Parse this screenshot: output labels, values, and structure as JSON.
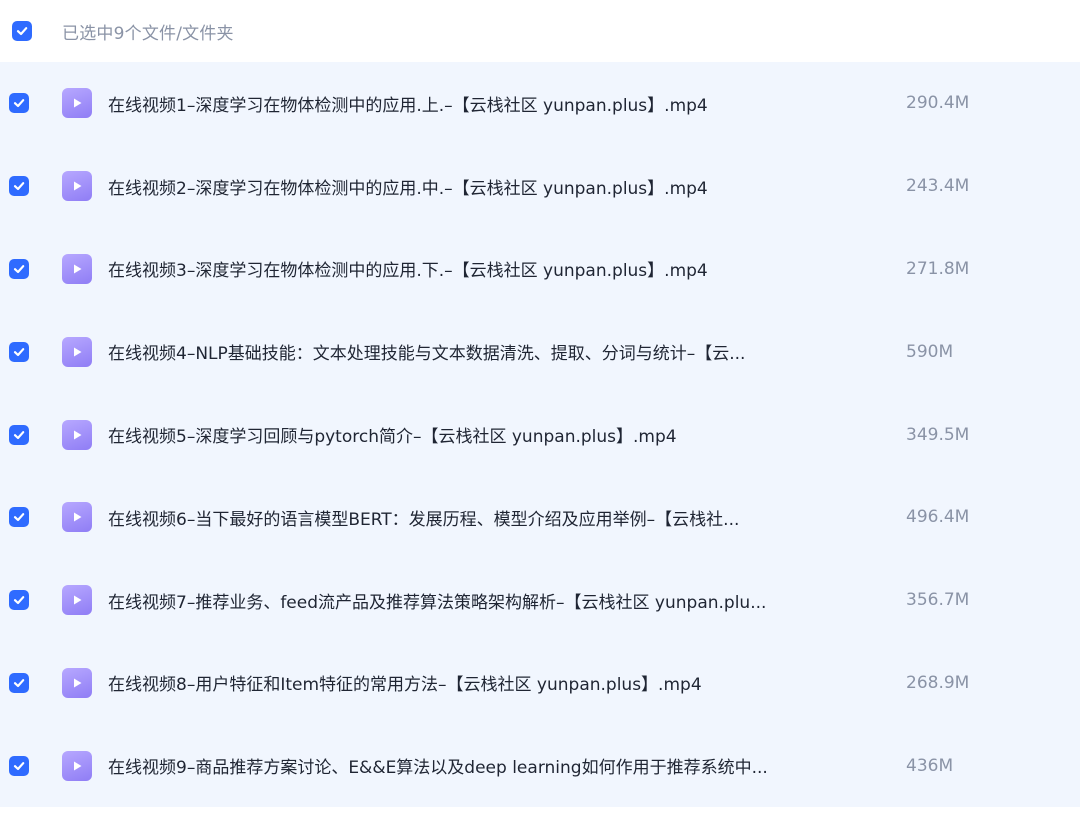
{
  "header": {
    "selection_label": "已选中9个文件/文件夹"
  },
  "files": [
    {
      "name": "在线视频1–深度学习在物体检测中的应用.上.–【云栈社区 yunpan.plus】.mp4",
      "size": "290.4M"
    },
    {
      "name": "在线视频2–深度学习在物体检测中的应用.中.–【云栈社区 yunpan.plus】.mp4",
      "size": "243.4M"
    },
    {
      "name": "在线视频3–深度学习在物体检测中的应用.下.–【云栈社区 yunpan.plus】.mp4",
      "size": "271.8M"
    },
    {
      "name": "在线视频4–NLP基础技能：文本处理技能与文本数据清洗、提取、分词与统计–【云...",
      "size": "590M"
    },
    {
      "name": "在线视频5–深度学习回顾与pytorch简介–【云栈社区 yunpan.plus】.mp4",
      "size": "349.5M"
    },
    {
      "name": "在线视频6–当下最好的语言模型BERT：发展历程、模型介绍及应用举例–【云栈社...",
      "size": "496.4M"
    },
    {
      "name": "在线视频7–推荐业务、feed流产品及推荐算法策略架构解析–【云栈社区 yunpan.plu...",
      "size": "356.7M"
    },
    {
      "name": "在线视频8–用户特征和Item特征的常用方法–【云栈社区 yunpan.plus】.mp4",
      "size": "268.9M"
    },
    {
      "name": "在线视频9–商品推荐方案讨论、E&&E算法以及deep learning如何作用于推荐系统中...",
      "size": "436M"
    }
  ],
  "icons": {
    "checkbox": "checkbox-checked-icon",
    "file": "video-file-icon"
  },
  "colors": {
    "accent": "#2f6bff",
    "list_background": "#f1f6fe",
    "file_icon": "#9f8ff8",
    "secondary_text": "#8a93a6",
    "primary_text": "#1f2533"
  }
}
